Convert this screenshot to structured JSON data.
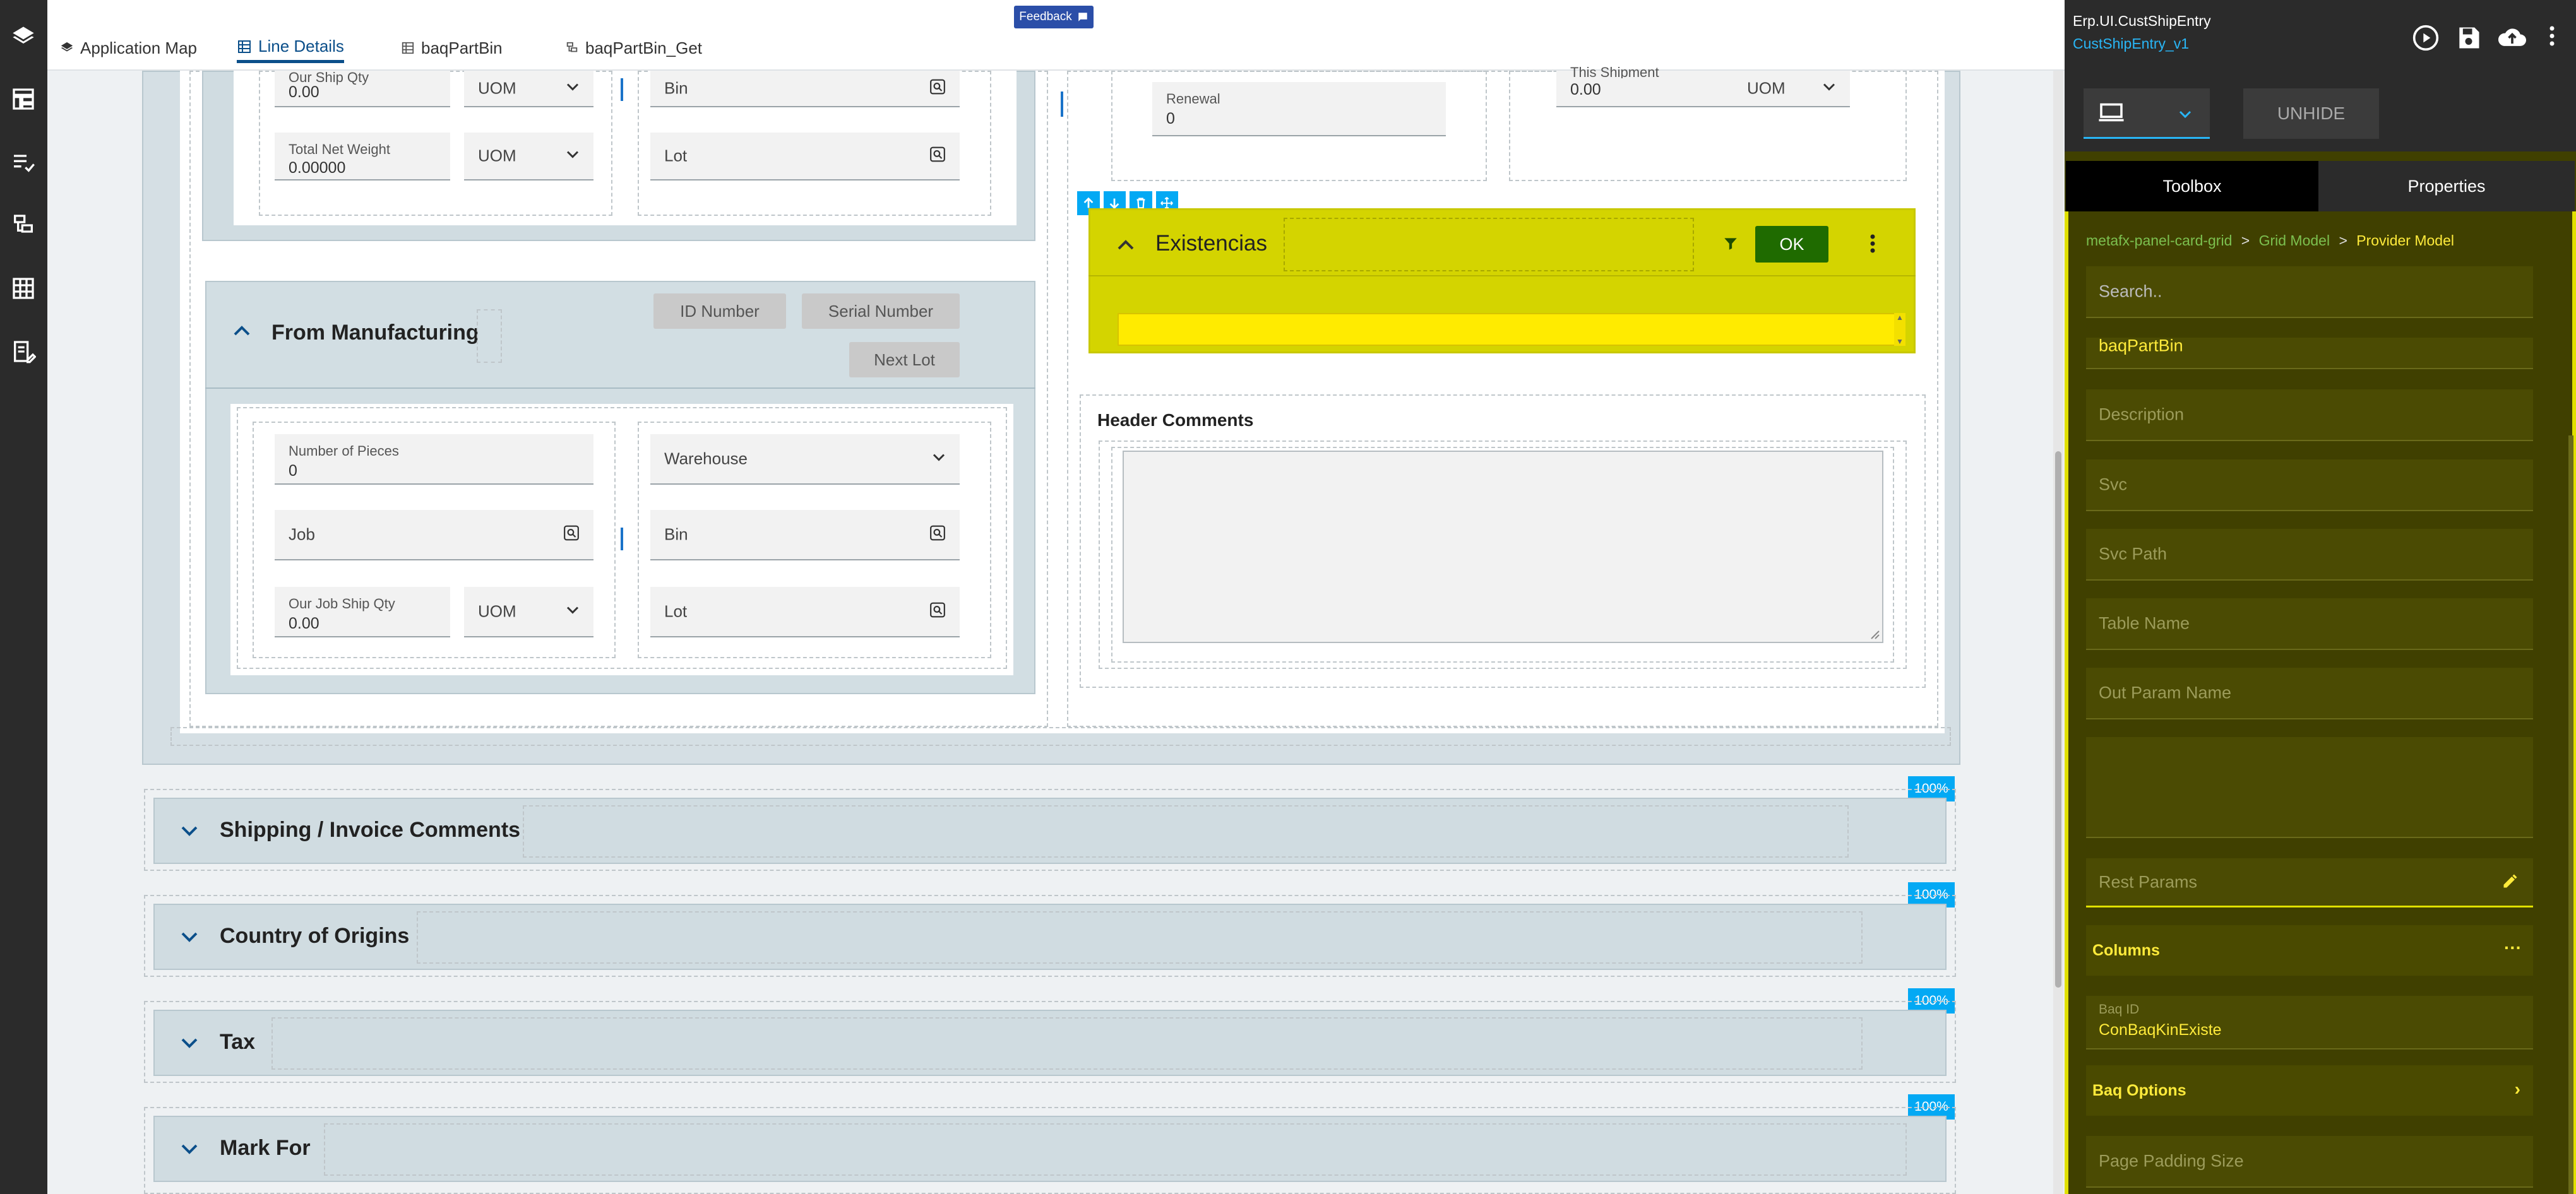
{
  "nav": {
    "tabs": [
      {
        "label": "Application Map"
      },
      {
        "label": "Line Details"
      },
      {
        "label": "baqPartBin"
      },
      {
        "label": "baqPartBin_Get"
      }
    ],
    "feedback": "Feedback"
  },
  "upper_left": {
    "our_ship_qty": {
      "label": "Our Ship Qty",
      "value": "0.00"
    },
    "uom1": "UOM",
    "bin1": "Bin",
    "total_net_weight": {
      "label": "Total Net Weight",
      "value": "0.00000"
    },
    "uom2": "UOM",
    "lot1": "Lot"
  },
  "upper_right": {
    "renewal": {
      "label": "Renewal",
      "value": "0"
    },
    "this_shipment": {
      "label": "This Shipment",
      "value": "0.00"
    },
    "uom": "UOM"
  },
  "manufacturing": {
    "title": "From Manufacturing",
    "id_number": "ID Number",
    "serial_number": "Serial Number",
    "next_lot": "Next Lot",
    "number_of_pieces": {
      "label": "Number of Pieces",
      "value": "0"
    },
    "warehouse": "Warehouse",
    "job": "Job",
    "bin": "Bin",
    "our_job_ship_qty": {
      "label": "Our Job Ship Qty",
      "value": "0.00"
    },
    "uom": "UOM",
    "lot": "Lot"
  },
  "existencias": {
    "title": "Existencias",
    "ok": "OK"
  },
  "header_comments": {
    "title": "Header Comments"
  },
  "collapsed_sections": [
    {
      "title": "Shipping / Invoice Comments",
      "pct": "100%"
    },
    {
      "title": "Country of Origins",
      "pct": "100%"
    },
    {
      "title": "Tax",
      "pct": "100%"
    },
    {
      "title": "Mark For",
      "pct": "100%"
    }
  ],
  "right_panel": {
    "app_name": "Erp.UI.CustShipEntry",
    "layer_name": "CustShipEntry_v1",
    "unhide": "UNHIDE",
    "tab_toolbox": "Toolbox",
    "tab_properties": "Properties",
    "breadcrumb": [
      "metafx-panel-card-grid",
      "Grid Model",
      "Provider Model"
    ],
    "search_placeholder": "Search..",
    "fields": {
      "baq_part_bin": "baqPartBin",
      "description": "Description",
      "svc": "Svc",
      "svc_path": "Svc Path",
      "table_name": "Table Name",
      "out_param_name": "Out Param Name",
      "rest_params": "Rest Params",
      "columns": "Columns",
      "baq_id_label": "Baq ID",
      "baq_id_value": "ConBaqKinExiste",
      "baq_options": "Baq Options",
      "page_padding_size": "Page Padding Size"
    }
  },
  "colors": {
    "accent_blue": "#0b4f8a",
    "highlight_yellow": "#d4d400",
    "ok_green": "#1f6b00",
    "dark_sidebar": "#2b2b2b",
    "toolbox_bg": "#404000",
    "badge_blue": "#03a9f4"
  }
}
